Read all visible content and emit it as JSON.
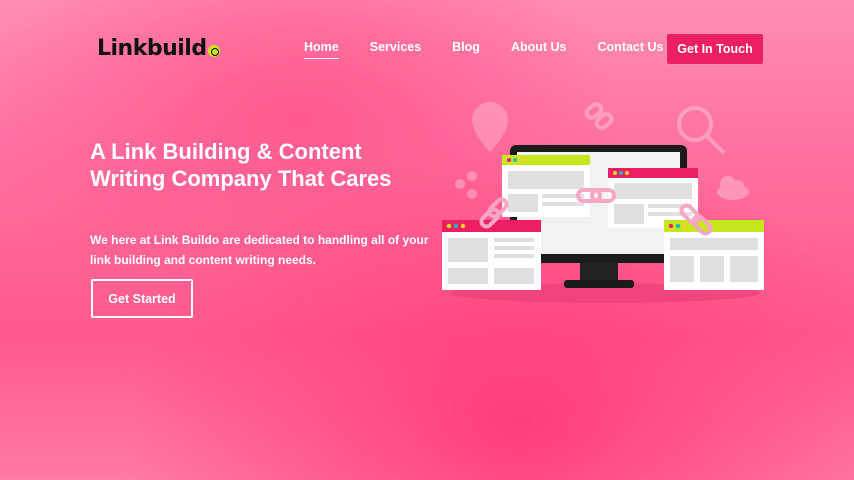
{
  "header": {
    "logo_text": "Linkbuild",
    "nav": [
      {
        "label": "Home",
        "active": true
      },
      {
        "label": "Services"
      },
      {
        "label": "Blog"
      },
      {
        "label": "About Us"
      },
      {
        "label": "Contact Us"
      }
    ],
    "cta_label": "Get In Touch"
  },
  "hero": {
    "title": "A Link Building & Content Writing Company That Cares",
    "subtitle": "We here at Link Buildo are dedicated to handling all of your link building and content writing needs.",
    "button_label": "Get Started"
  },
  "colors": {
    "accent": "#ec1f63",
    "logo_accent": "#c8e61e",
    "text": "#ffffff"
  },
  "icons": [
    "location-pin-icon",
    "chain-link-icon",
    "analytics-search-icon",
    "share-icon",
    "cloud-icon"
  ]
}
